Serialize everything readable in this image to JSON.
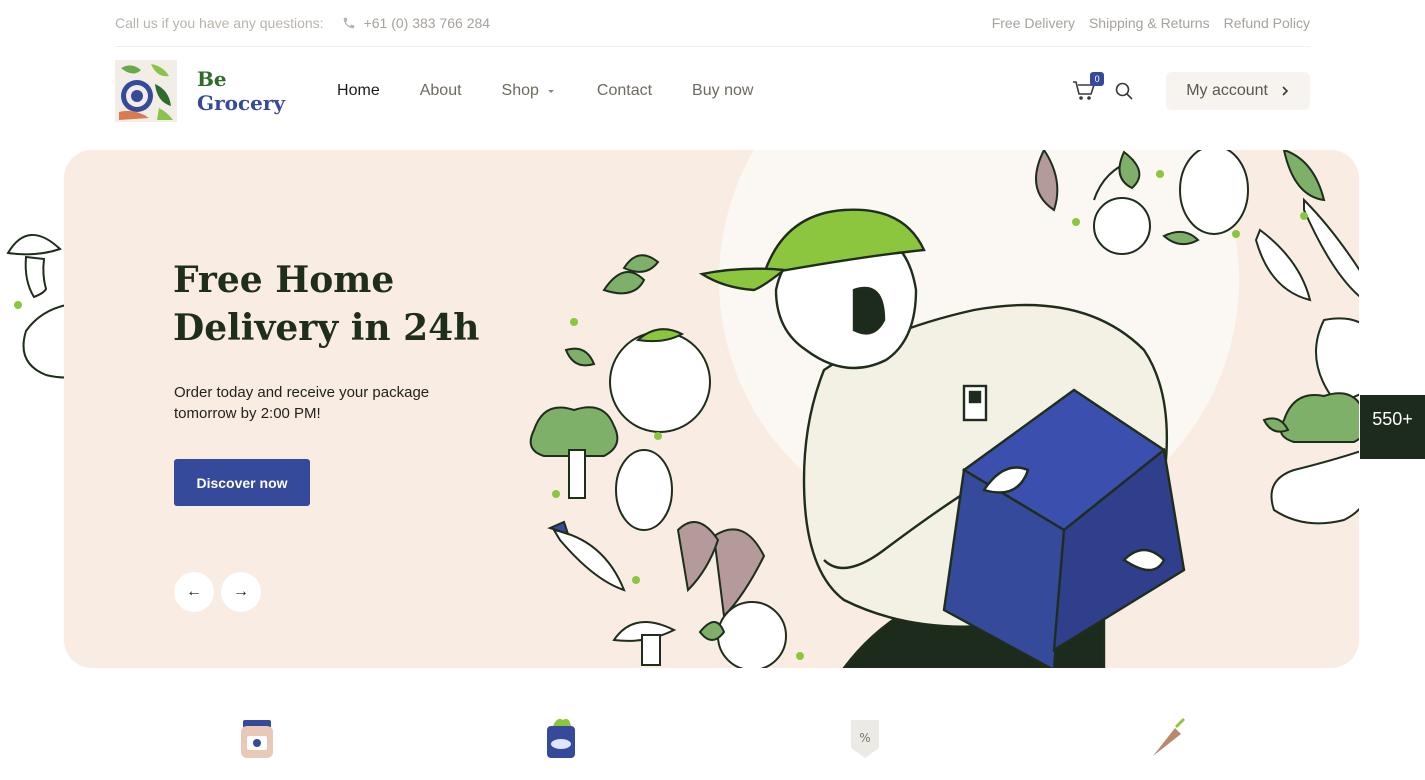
{
  "topbar": {
    "question_text": "Call us if you have any questions:",
    "phone": "+61 (0) 383 766 284",
    "links": [
      "Free Delivery",
      "Shipping & Returns",
      "Refund Policy"
    ]
  },
  "header": {
    "logo_line1": "Be",
    "logo_line2": "Grocery",
    "nav": [
      "Home",
      "About",
      "Shop",
      "Contact",
      "Buy now"
    ],
    "cart_count": "0",
    "account_label": "My account"
  },
  "hero": {
    "title": "Free Home Delivery in 24h",
    "subtitle": "Order today and receive your package tomorrow by 2:00 PM!",
    "button_label": "Discover now",
    "prev_arrow": "←",
    "next_arrow": "→"
  },
  "side_badge": {
    "text": "550+"
  },
  "colors": {
    "brand_blue": "#364a9b",
    "brand_green": "#2f6b2a",
    "hero_bg": "#f8ece3",
    "accent_lime": "#8cc63f"
  },
  "icons": [
    "phone-icon",
    "cart-icon",
    "search-icon",
    "chevron-right-icon",
    "chevron-down-icon",
    "jar-icon",
    "bag-icon",
    "discount-tag-icon",
    "carrot-icon"
  ]
}
